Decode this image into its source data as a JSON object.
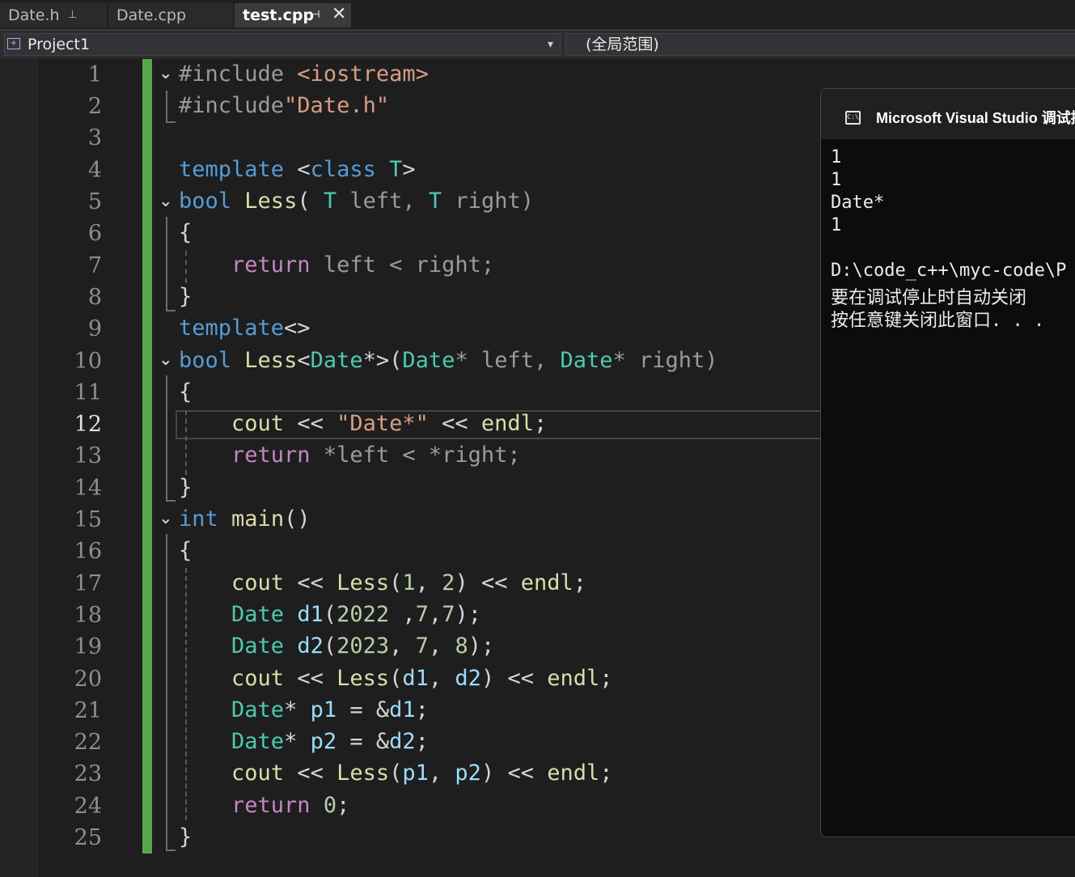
{
  "tabs": [
    {
      "label": "Date.h",
      "pin": "⊥",
      "active": false
    },
    {
      "label": "Date.cpp",
      "active": false
    },
    {
      "label": "test.cpp",
      "pin": "⊣",
      "close": "✕",
      "active": true
    }
  ],
  "navbar": {
    "project": "Project1",
    "scope": "(全局范围)",
    "dropdown_icon": "▾"
  },
  "editor": {
    "current_line": 12,
    "line_numbers": [
      "1",
      "2",
      "3",
      "4",
      "5",
      "6",
      "7",
      "8",
      "9",
      "10",
      "11",
      "12",
      "13",
      "14",
      "15",
      "16",
      "17",
      "18",
      "19",
      "20",
      "21",
      "22",
      "23",
      "24",
      "25"
    ],
    "fold_glyph": "⌄",
    "lines": {
      "l1": [
        "#include ",
        "<iostream>"
      ],
      "l2": [
        "#include",
        "\"Date.h\""
      ],
      "l4": [
        "template ",
        "<",
        "class",
        " T",
        ">"
      ],
      "l5": [
        "bool",
        " ",
        "Less",
        "( ",
        "T",
        " left, ",
        "T",
        " right)"
      ],
      "l6": [
        "{"
      ],
      "l7": [
        "return",
        " left < right;"
      ],
      "l8": [
        "}"
      ],
      "l9": [
        "template",
        "<>"
      ],
      "l10": [
        "bool",
        " ",
        "Less",
        "<",
        "Date",
        "*>(",
        "Date",
        "* left, ",
        "Date",
        "* right)"
      ],
      "l11": [
        "{"
      ],
      "l12": [
        "cout",
        " << ",
        "\"Date*\"",
        " << ",
        "endl",
        ";"
      ],
      "l13": [
        "return",
        " *left < *right;"
      ],
      "l14": [
        "}"
      ],
      "l15": [
        "int",
        " ",
        "main",
        "()"
      ],
      "l16": [
        "{"
      ],
      "l17": [
        "cout",
        " << ",
        "Less",
        "(",
        "1",
        ", ",
        "2",
        ") << ",
        "endl",
        ";"
      ],
      "l18": [
        "Date",
        " ",
        "d1",
        "(",
        "2022",
        " ,",
        "7",
        ",",
        "7",
        ");"
      ],
      "l19": [
        "Date",
        " ",
        "d2",
        "(",
        "2023",
        ", ",
        "7",
        ", ",
        "8",
        ");"
      ],
      "l20": [
        "cout",
        " << ",
        "Less",
        "(",
        "d1",
        ", ",
        "d2",
        ") << ",
        "endl",
        ";"
      ],
      "l21": [
        "Date",
        "* ",
        "p1",
        " = &",
        "d1",
        ";"
      ],
      "l22": [
        "Date",
        "* ",
        "p2",
        " = &",
        "d2",
        ";"
      ],
      "l23": [
        "cout",
        " << ",
        "Less",
        "(",
        "p1",
        ", ",
        "p2",
        ") << ",
        "endl",
        ";"
      ],
      "l24": [
        "return",
        " ",
        "0",
        ";"
      ],
      "l25": [
        "}"
      ]
    }
  },
  "console": {
    "title": "Microsoft Visual Studio 调试控",
    "icon": "cmd-icon",
    "output": [
      "1",
      "1",
      "Date*",
      "1",
      "",
      "D:\\code_c++\\myc-code\\P",
      "要在调试停止时自动关闭",
      "按任意键关闭此窗口. . ."
    ]
  },
  "colors": {
    "keyword": "#569cd6",
    "type": "#4ec9b0",
    "function": "#dcdcaa",
    "string": "#d69d85",
    "control": "#c586c0",
    "number": "#b5cea8",
    "variable": "#9cdcfe",
    "change_bar": "#57a64a"
  }
}
